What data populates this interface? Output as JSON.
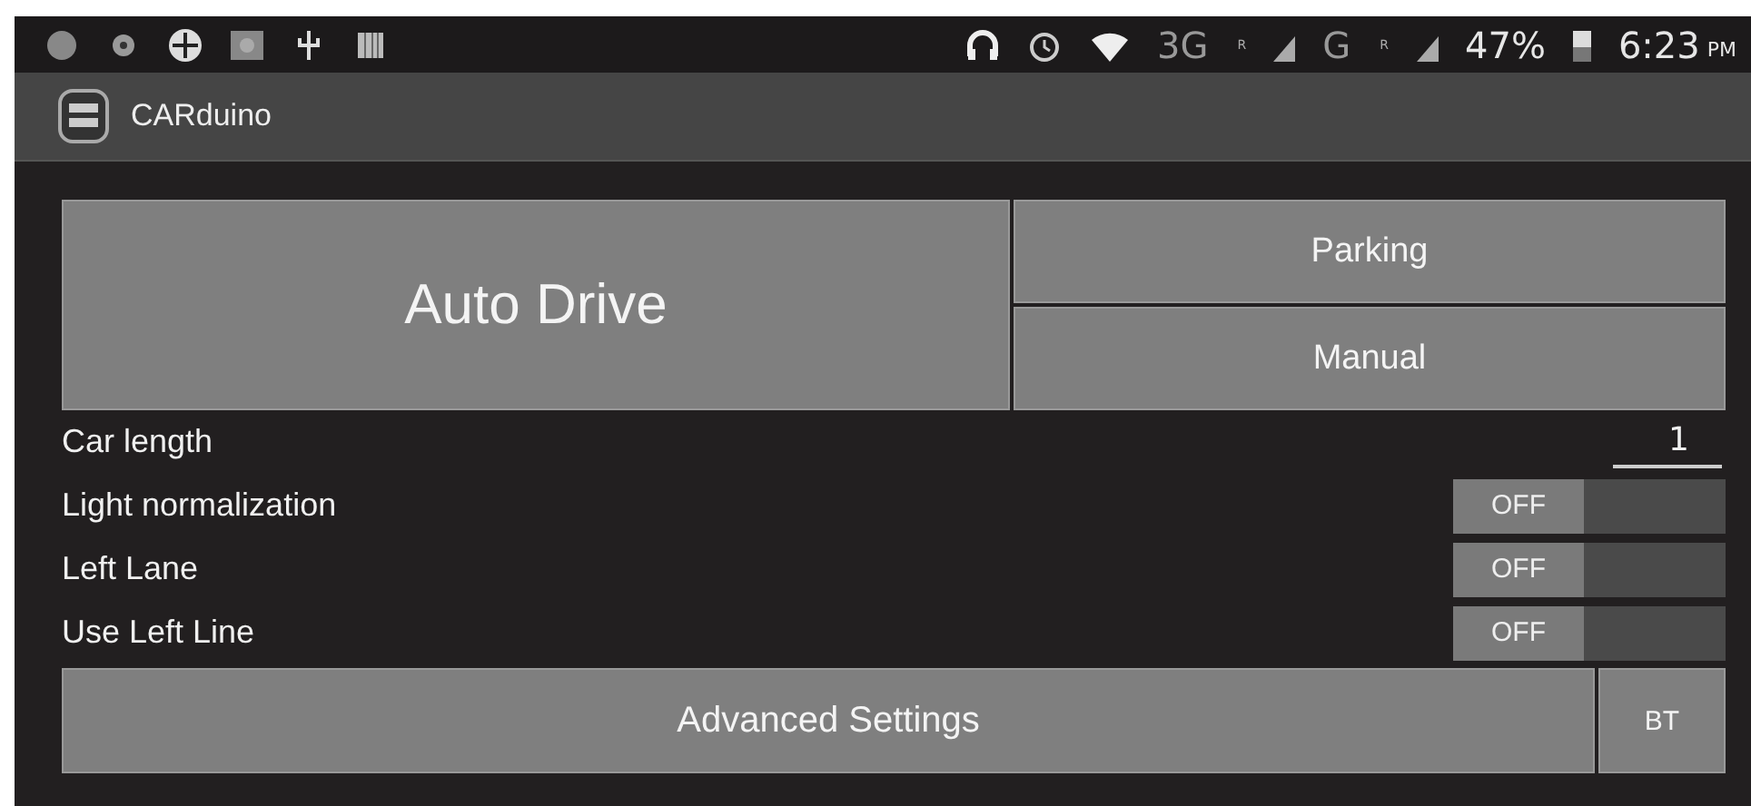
{
  "status_bar": {
    "networks": [
      {
        "label": "3G",
        "roaming": "R"
      },
      {
        "label": "G",
        "roaming": "R"
      }
    ],
    "battery": "47%",
    "time": "6:23",
    "meridiem": "PM"
  },
  "app_bar": {
    "title": "CARduino"
  },
  "modes": {
    "primary": {
      "label": "Auto Drive",
      "selected": false
    },
    "secondary": [
      {
        "label": "Parking",
        "selected": false
      },
      {
        "label": "Manual",
        "selected": false
      }
    ]
  },
  "settings": [
    {
      "kind": "number",
      "label": "Car length",
      "value": "1"
    },
    {
      "kind": "toggle",
      "label": "Light normalization",
      "on": false,
      "state_text": "OFF"
    },
    {
      "kind": "toggle",
      "label": "Left Lane",
      "on": false,
      "state_text": "OFF"
    },
    {
      "kind": "toggle",
      "label": "Use Left Line",
      "on": false,
      "state_text": "OFF"
    }
  ],
  "buttons": [
    {
      "label": "Advanced Settings"
    },
    {
      "label": "BT"
    }
  ]
}
